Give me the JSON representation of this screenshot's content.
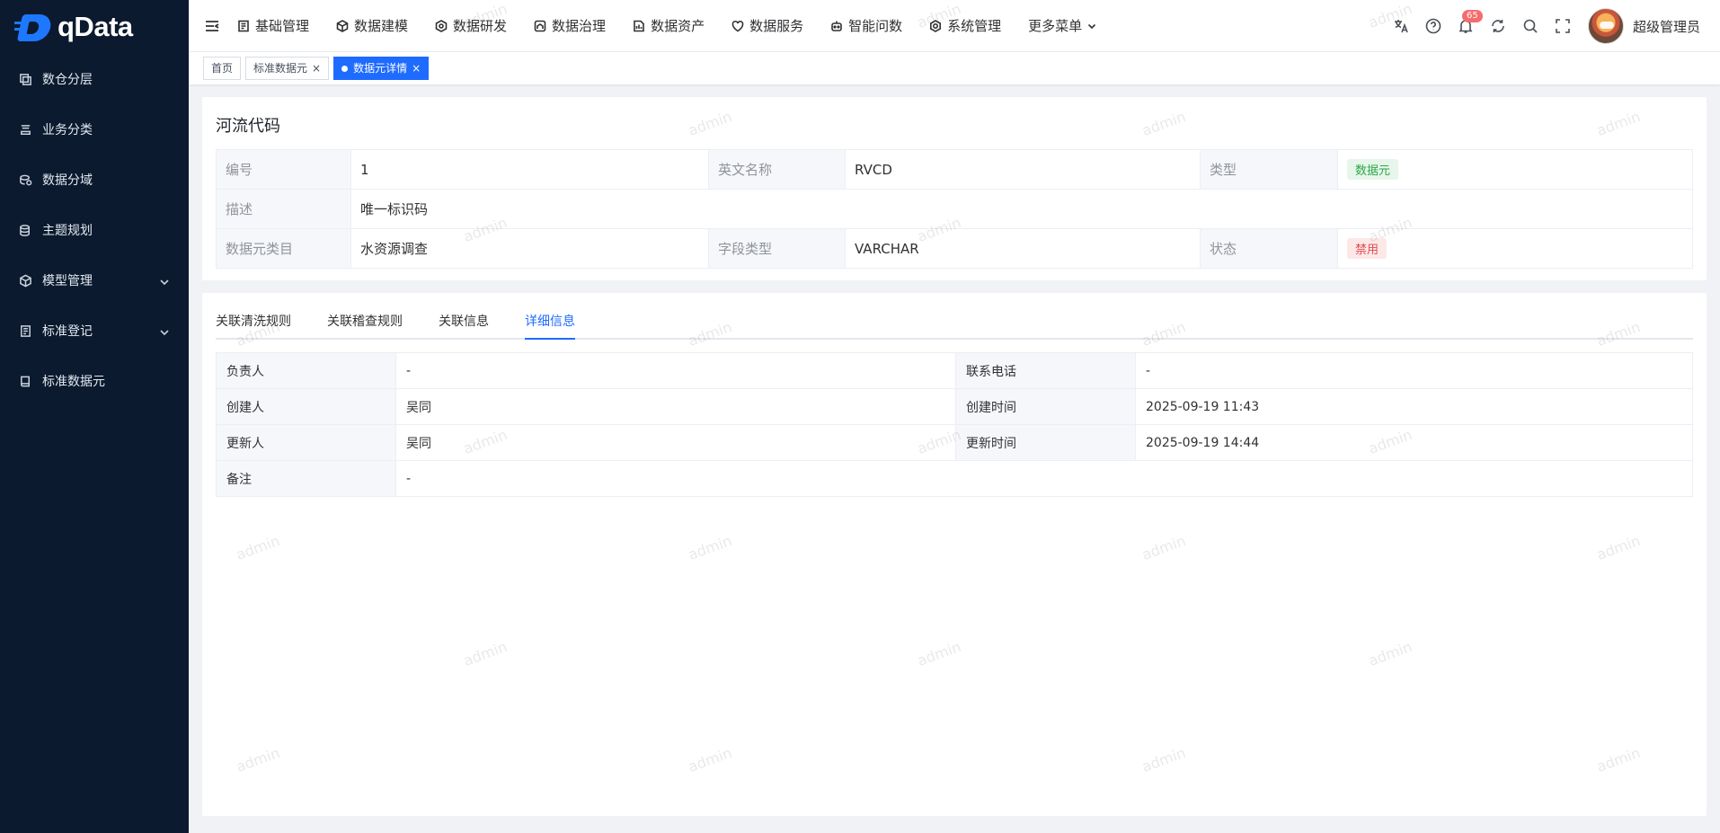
{
  "app": {
    "logo_text": "qData"
  },
  "sidebar": {
    "items": [
      {
        "label": "数仓分层",
        "icon": "layers-icon",
        "expandable": false
      },
      {
        "label": "业务分类",
        "icon": "stack-icon",
        "expandable": false
      },
      {
        "label": "数据分域",
        "icon": "domain-icon",
        "expandable": false
      },
      {
        "label": "主题规划",
        "icon": "database-icon",
        "expandable": false
      },
      {
        "label": "模型管理",
        "icon": "cube-icon",
        "expandable": true
      },
      {
        "label": "标准登记",
        "icon": "register-icon",
        "expandable": true
      },
      {
        "label": "标准数据元",
        "icon": "book-icon",
        "expandable": false
      }
    ]
  },
  "header": {
    "nav": [
      {
        "label": "基础管理",
        "icon": "doc-icon"
      },
      {
        "label": "数据建模",
        "icon": "cube-icon"
      },
      {
        "label": "数据研发",
        "icon": "hexagon-icon"
      },
      {
        "label": "数据治理",
        "icon": "shield-icon"
      },
      {
        "label": "数据资产",
        "icon": "asset-icon"
      },
      {
        "label": "数据服务",
        "icon": "heart-icon"
      },
      {
        "label": "智能问数",
        "icon": "robot-icon"
      },
      {
        "label": "系统管理",
        "icon": "gear-icon"
      },
      {
        "label": "更多菜单",
        "icon": "chevron-down-icon"
      }
    ],
    "notification_count": "65",
    "username": "超级管理员"
  },
  "tags": [
    {
      "label": "首页",
      "closable": false,
      "active": false
    },
    {
      "label": "标准数据元",
      "closable": true,
      "active": false
    },
    {
      "label": "数据元详情",
      "closable": true,
      "active": true
    }
  ],
  "detail": {
    "title": "河流代码",
    "fields": {
      "id_label": "编号",
      "id_value": "1",
      "en_label": "英文名称",
      "en_value": "RVCD",
      "type_label": "类型",
      "type_value": "数据元",
      "desc_label": "描述",
      "desc_value": "唯一标识码",
      "category_label": "数据元类目",
      "category_value": "水资源调查",
      "fieldtype_label": "字段类型",
      "fieldtype_value": "VARCHAR",
      "status_label": "状态",
      "status_value": "禁用"
    }
  },
  "tabs": {
    "items": [
      "关联清洗规则",
      "关联稽查规则",
      "关联信息",
      "详细信息"
    ],
    "active": "详细信息"
  },
  "info": {
    "owner_label": "负责人",
    "owner_value": "-",
    "phone_label": "联系电话",
    "phone_value": "-",
    "creator_label": "创建人",
    "creator_value": "吴同",
    "created_label": "创建时间",
    "created_value": "2025-09-19 11:43",
    "updater_label": "更新人",
    "updater_value": "吴同",
    "updated_label": "更新时间",
    "updated_value": "2025-09-19 14:44",
    "remark_label": "备注",
    "remark_value": "-"
  },
  "watermark": "admin",
  "colors": {
    "sidebar_bg": "#0b1a2f",
    "accent": "#1e6bff",
    "tag_green": "#2ea64a",
    "tag_red": "#e04b4b"
  }
}
